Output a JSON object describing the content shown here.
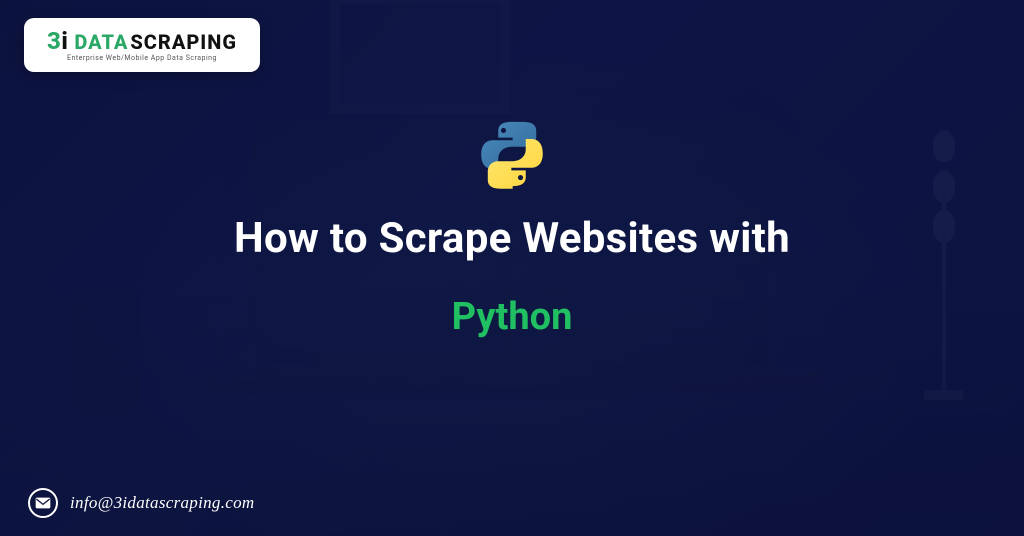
{
  "brand": {
    "prefix_colored": "3",
    "prefix_black": "i",
    "word_green": "DATA",
    "word_black": "SCRAPING",
    "tagline": "Enterprise Web/Mobile App Data Scraping"
  },
  "hero": {
    "icon_name": "python-logo-icon",
    "title_line1": "How to Scrape Websites with",
    "title_line2": "Python"
  },
  "contact": {
    "icon_name": "email-icon",
    "email": "info@3idatascraping.com"
  },
  "colors": {
    "background_navy": "#0d1442",
    "accent_green": "#1fbf62",
    "brand_green": "#2aa866",
    "white": "#ffffff"
  }
}
